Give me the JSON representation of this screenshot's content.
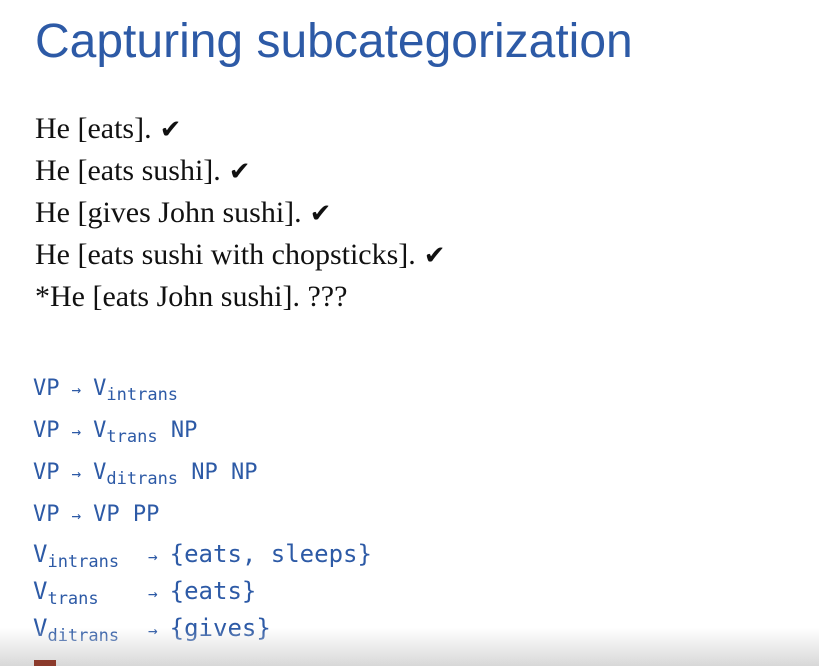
{
  "title": "Capturing subcategorization",
  "examples": [
    {
      "text": "He [eats].",
      "mark": "✔"
    },
    {
      "text": "He [eats sushi].",
      "mark": "✔"
    },
    {
      "text": "He [gives John sushi].",
      "mark": "✔"
    },
    {
      "text": "He [eats sushi with chopsticks].",
      "mark": "✔"
    },
    {
      "text": "*He [eats John sushi]. ???",
      "mark": ""
    }
  ],
  "arrow": "→",
  "rules": [
    {
      "lhs": "VP",
      "v": "V",
      "sub": "intrans",
      "rest": ""
    },
    {
      "lhs": "VP",
      "v": "V",
      "sub": "trans",
      "rest": "NP"
    },
    {
      "lhs": "VP",
      "v": "V",
      "sub": "ditrans",
      "rest": "NP NP"
    },
    {
      "lhs": "VP",
      "v": "VP PP",
      "sub": "",
      "rest": ""
    }
  ],
  "lexicon": [
    {
      "v": "V",
      "sub": "intrans",
      "words": "{eats, sleeps}"
    },
    {
      "v": "V",
      "sub": "trans",
      "words": "{eats}"
    },
    {
      "v": "V",
      "sub": "ditrans",
      "words": "{gives}"
    }
  ],
  "colors": {
    "accent": "#2d5aa6",
    "text": "#111111"
  }
}
